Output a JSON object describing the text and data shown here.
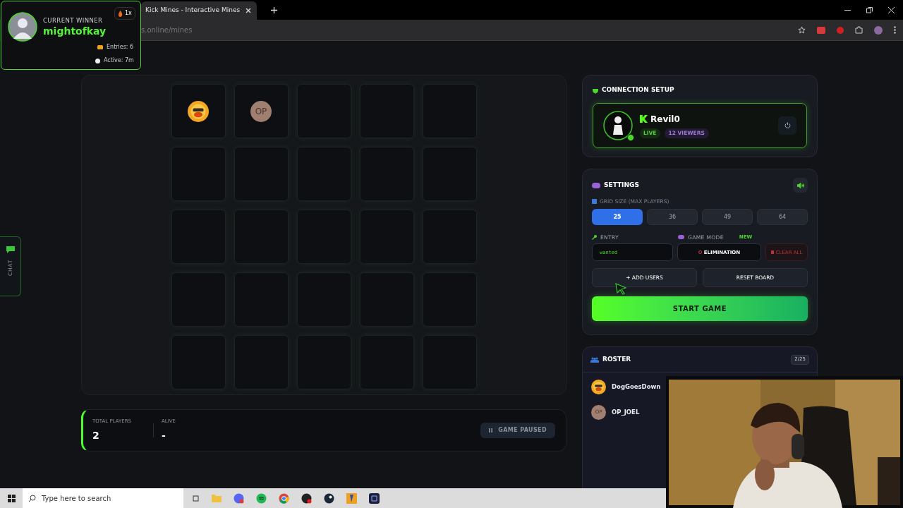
{
  "browser": {
    "tab_title": "Kick Mines - Interactive Mines",
    "address": "s.online/mines"
  },
  "winner": {
    "label": "CURRENT WINNER",
    "name": "mightofkay",
    "streak": "1x",
    "entries": "Entries: 6",
    "active": "Active: 7m"
  },
  "chat_tab": {
    "label": "CHAT"
  },
  "board": {
    "tiles": [
      {
        "kind": "avatar"
      },
      {
        "kind": "initials",
        "text": "OP"
      },
      {
        "kind": "empty"
      },
      {
        "kind": "empty"
      },
      {
        "kind": "empty"
      },
      {
        "kind": "empty"
      },
      {
        "kind": "empty"
      },
      {
        "kind": "empty"
      },
      {
        "kind": "empty"
      },
      {
        "kind": "empty"
      },
      {
        "kind": "empty"
      },
      {
        "kind": "empty"
      },
      {
        "kind": "empty"
      },
      {
        "kind": "empty"
      },
      {
        "kind": "empty"
      },
      {
        "kind": "empty"
      },
      {
        "kind": "empty"
      },
      {
        "kind": "empty"
      },
      {
        "kind": "empty"
      },
      {
        "kind": "empty"
      },
      {
        "kind": "empty"
      },
      {
        "kind": "empty"
      },
      {
        "kind": "empty"
      },
      {
        "kind": "empty"
      },
      {
        "kind": "empty"
      }
    ]
  },
  "stats": {
    "total_label": "TOTAL PLAYERS",
    "total": "2",
    "alive_label": "ALIVE",
    "alive": "-",
    "status": "GAME PAUSED"
  },
  "connection": {
    "title": "CONNECTION SETUP",
    "channel": "Revil0",
    "online": true,
    "live": "LIVE",
    "viewers": "12 VIEWERS"
  },
  "settings": {
    "title": "SETTINGS",
    "grid_label": "GRID SIZE (MAX PLAYERS)",
    "grid_sizes": [
      {
        "label": "25",
        "selected": true
      },
      {
        "label": "36",
        "selected": false
      },
      {
        "label": "49",
        "selected": false
      },
      {
        "label": "64",
        "selected": false
      }
    ],
    "entry_label": "ENTRY",
    "entry_value": "wanted",
    "mode_label": "GAME MODE",
    "mode_badge": "NEW",
    "mode_value": "ELIMINATION",
    "clear": "CLEAR ALL",
    "add_users": "+ ADD USERS",
    "reset": "RESET BOARD",
    "start": "START GAME"
  },
  "roster": {
    "title": "ROSTER",
    "count": "2/25",
    "players": [
      {
        "name": "DogGoesDown",
        "kind": "avatar"
      },
      {
        "name": "OP_JOEL",
        "kind": "initials",
        "initials": "OP"
      }
    ]
  },
  "taskbar": {
    "search_placeholder": "Type here to search"
  }
}
